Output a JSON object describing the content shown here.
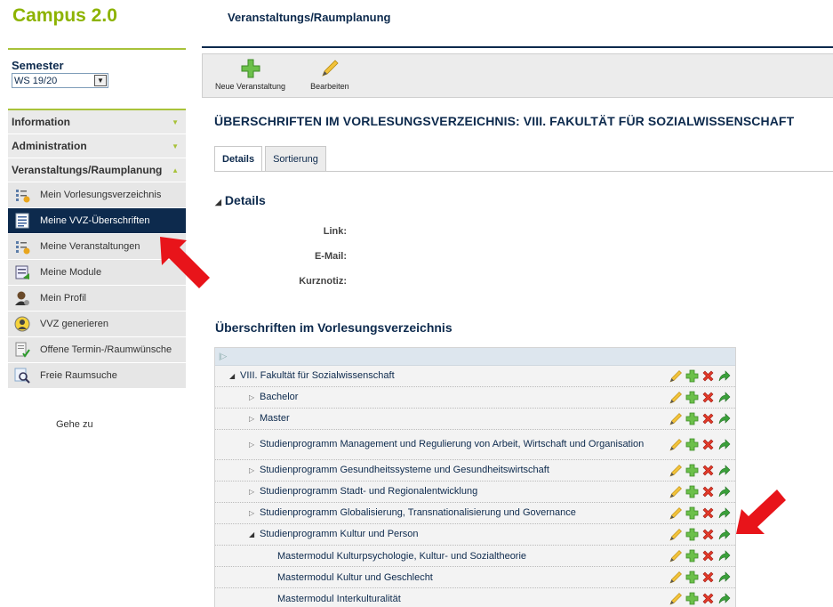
{
  "app": {
    "logo": "Campus 2.0",
    "page_heading": "Veranstaltungs/Raumplanung"
  },
  "semester": {
    "label": "Semester",
    "value": "WS 19/20"
  },
  "nav": {
    "sections": [
      "Information",
      "Administration",
      "Veranstaltungs/Raumplanung"
    ],
    "items": [
      {
        "label": "Mein Vorlesungsverzeichnis",
        "icon": "lecture-list-icon",
        "active": false
      },
      {
        "label": "Meine VVZ-Überschriften",
        "icon": "document-list-icon",
        "active": true
      },
      {
        "label": "Meine Veranstaltungen",
        "icon": "lecture-list-icon",
        "active": false
      },
      {
        "label": "Meine Module",
        "icon": "module-icon",
        "active": false
      },
      {
        "label": "Mein Profil",
        "icon": "profile-icon",
        "active": false
      },
      {
        "label": "VVZ generieren",
        "icon": "generate-icon",
        "active": false
      },
      {
        "label": "Offene Termin-/Raumwünsche",
        "icon": "open-requests-icon",
        "active": false
      },
      {
        "label": "Freie Raumsuche",
        "icon": "room-search-icon",
        "active": false
      }
    ],
    "goto": "Gehe zu"
  },
  "toolbar": {
    "new_label": "Neue Veranstaltung",
    "edit_label": "Bearbeiten"
  },
  "main": {
    "title": "ÜBERSCHRIFTEN IM VORLESUNGSVERZEICHNIS: VIII. FAKULTÄT FÜR SOZIALWISSENSCHAFT",
    "tabs": [
      "Details",
      "Sortierung"
    ],
    "details_heading": "Details",
    "fields": {
      "link": "Link:",
      "email": "E-Mail:",
      "note": "Kurznotiz:"
    },
    "vvz_heading": "Überschriften im Vorlesungsverzeichnis"
  },
  "tree": {
    "rows": [
      {
        "label": "VIII. Fakultät für Sozialwissenschaft",
        "level": 0,
        "arrow": "open"
      },
      {
        "label": "Bachelor",
        "level": 1,
        "arrow": "closed"
      },
      {
        "label": "Master",
        "level": 1,
        "arrow": "closed"
      },
      {
        "label": "Studienprogramm Management und Regulierung von Arbeit, Wirtschaft und Organisation",
        "level": 1,
        "arrow": "closed"
      },
      {
        "label": "Studienprogramm Gesundheitssysteme und Gesundheitswirtschaft",
        "level": 1,
        "arrow": "closed"
      },
      {
        "label": "Studienprogramm Stadt- und Regionalentwicklung",
        "level": 1,
        "arrow": "closed"
      },
      {
        "label": "Studienprogramm Globalisierung, Transnationalisierung und Governance",
        "level": 1,
        "arrow": "closed"
      },
      {
        "label": "Studienprogramm Kultur und Person",
        "level": 1,
        "arrow": "open"
      },
      {
        "label": "Mastermodul Kulturpsychologie, Kultur- und Sozialtheorie",
        "level": 2,
        "arrow": "none"
      },
      {
        "label": "Mastermodul Kultur und Geschlecht",
        "level": 2,
        "arrow": "none"
      },
      {
        "label": "Mastermodul Interkulturalität",
        "level": 2,
        "arrow": "none"
      }
    ]
  },
  "colors": {
    "brand_green": "#8db300",
    "navy": "#0d2a4d",
    "annotation_red": "#e8141a"
  }
}
